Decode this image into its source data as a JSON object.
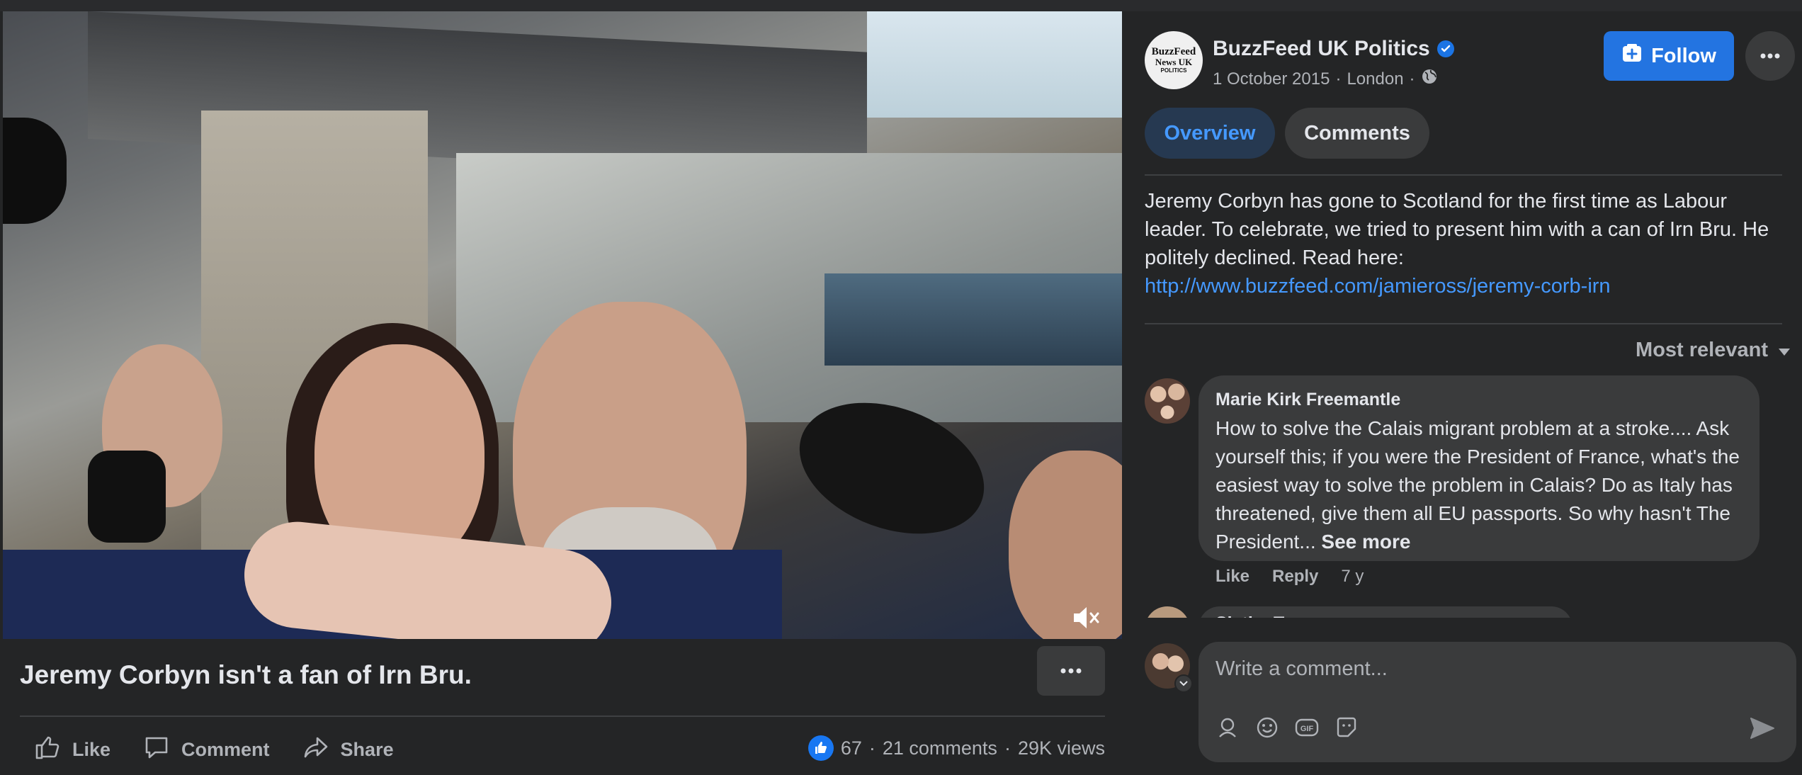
{
  "post": {
    "title": "Jeremy Corbyn isn't a fan of Irn Bru.",
    "actions": {
      "like": "Like",
      "comment": "Comment",
      "share": "Share"
    },
    "stats": {
      "reactions": "67",
      "comments": "21 comments",
      "views": "29K views",
      "sep": "·"
    }
  },
  "page": {
    "name": "BuzzFeed UK Politics",
    "avatar_lines": [
      "BuzzFeed",
      "News UK",
      "POLITICS"
    ],
    "date": "1 October 2015",
    "location": "London",
    "sep": "·",
    "follow_label": "Follow"
  },
  "tabs": [
    {
      "label": "Overview",
      "active": true
    },
    {
      "label": "Comments",
      "active": false
    }
  ],
  "description": {
    "text": "Jeremy Corbyn has gone to Scotland for the first time as Labour leader. To celebrate, we tried to present him with a can of Irn Bru. He politely declined. Read here:",
    "link": "http://www.buzzfeed.com/jamieross/jeremy-corb-irn"
  },
  "comments": {
    "sort_label": "Most relevant",
    "items": [
      {
        "author": "Marie Kirk Freemantle",
        "text": "How to solve the Calais migrant problem at a stroke.... Ask yourself this; if you were the President of France, what's the easiest way to solve the problem in Calais? Do as Italy has threatened, give them all EU passports. So why hasn't The President...",
        "see_more": "See more",
        "like": "Like",
        "reply": "Reply",
        "time": "7 y"
      },
      {
        "author": "Slythy Tove"
      }
    ]
  },
  "composer": {
    "placeholder": "Write a comment..."
  },
  "colors": {
    "accent": "#2374e1",
    "link": "#4599ff",
    "surface": "#242526",
    "bubble": "#3a3b3c"
  },
  "icons": [
    "volume-muted-icon",
    "ellipsis-icon",
    "thumbs-up-icon",
    "comment-icon",
    "share-icon",
    "verified-icon",
    "globe-icon",
    "follow-plus-icon",
    "caret-down-icon",
    "sticker-icon",
    "emoji-icon",
    "gif-icon",
    "avatar-sticker-icon",
    "send-icon",
    "chevron-down-icon"
  ]
}
